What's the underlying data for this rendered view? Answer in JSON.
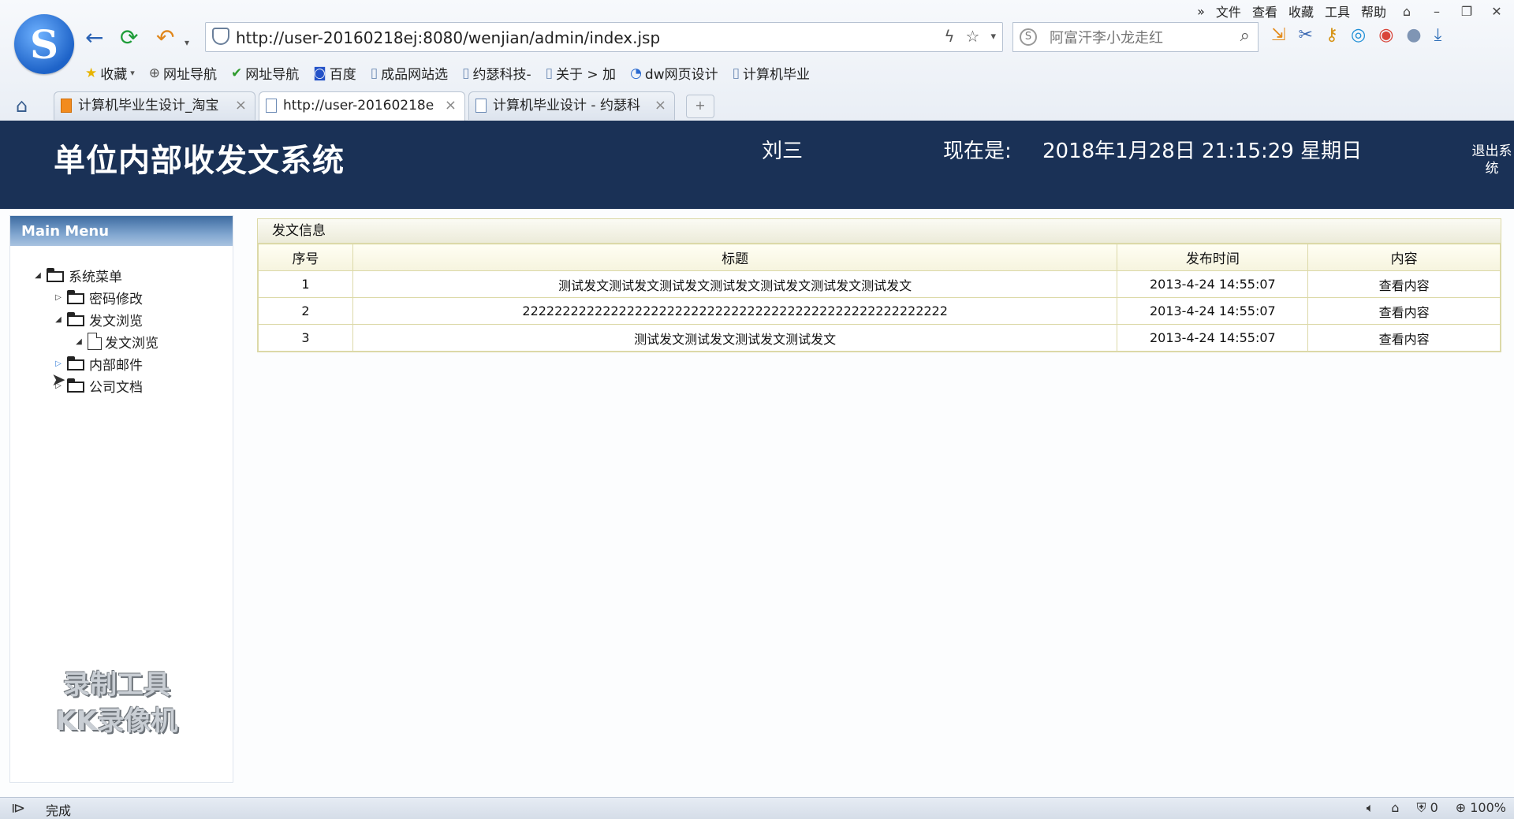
{
  "browser": {
    "top_menu": [
      "文件",
      "查看",
      "收藏",
      "工具",
      "帮助"
    ],
    "url": "http://user-20160218ej:8080/wenjian/admin/index.jsp",
    "search_placeholder": "阿富汗李小龙走红",
    "bookmarks": [
      "收藏",
      "网址导航",
      "网址导航",
      "百度",
      "成品网站选",
      "约瑟科技-",
      "关于 > 加",
      "dw网页设计",
      "计算机毕业"
    ],
    "tabs": [
      {
        "label": "计算机毕业生设计_淘宝"
      },
      {
        "label": "http://user-20160218e"
      },
      {
        "label": "计算机毕业设计 - 约瑟科"
      }
    ]
  },
  "header": {
    "title": "单位内部收发文系统",
    "user": "刘三",
    "now_label": "现在是:",
    "datetime": "2018年1月28日  21:15:29  星期日",
    "logout": "退出系统"
  },
  "sidebar": {
    "title": "Main Menu",
    "tree": {
      "root": "系统菜单",
      "password": "密码修改",
      "browse_group": "发文浏览",
      "browse_leaf": "发文浏览",
      "mail": "内部邮件",
      "docs": "公司文档"
    },
    "watermark": [
      "录制工具",
      "KK录像机"
    ]
  },
  "panel": {
    "title": "发文信息",
    "columns": [
      "序号",
      "标题",
      "发布时间",
      "内容"
    ],
    "rows": [
      {
        "no": "1",
        "title": "测试发文测试发文测试发文测试发文测试发文测试发文测试发文",
        "time": "2013-4-24 14:55:07",
        "action": "查看内容"
      },
      {
        "no": "2",
        "title": "22222222222222222222222222222222222222222222222222222",
        "time": "2013-4-24 14:55:07",
        "action": "查看内容"
      },
      {
        "no": "3",
        "title": "测试发文测试发文测试发文测试发文",
        "time": "2013-4-24 14:55:07",
        "action": "查看内容"
      }
    ]
  },
  "status": {
    "text": "完成",
    "mute_count": "0",
    "zoom": "100%"
  },
  "colors": {
    "header_bg": "#1a3156",
    "panel_border": "#dcd9a8",
    "menu_header": "#4f7db3"
  }
}
